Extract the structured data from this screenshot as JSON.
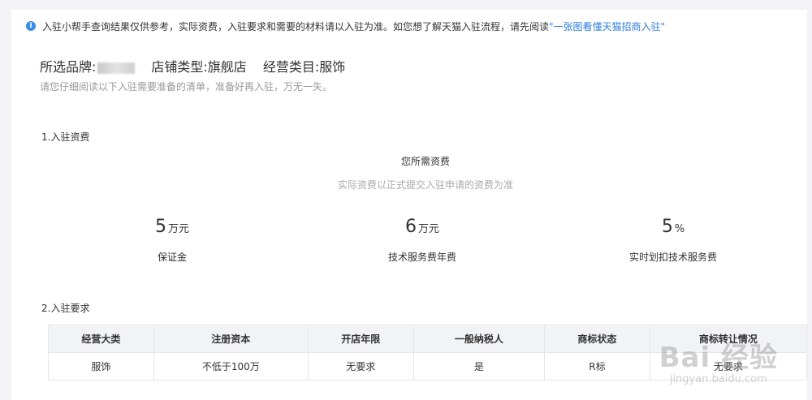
{
  "notice": {
    "text": "入驻小帮手查询结果仅供参考，实际资费，入驻要求和需要的材料请以入驻为准。如您想了解天猫入驻流程，请先阅读 ",
    "link": "\"一张图看懂天猫招商入驻\""
  },
  "selection": {
    "brand_label": "所选品牌:",
    "shop_type": "店铺类型:旗舰店",
    "category": "经营类目:服饰",
    "tip": "请您仔细阅读以下入驻需要准备的清单，准备好再入驻，万无一失。"
  },
  "section1": {
    "title": "1.入驻资费",
    "head": "您所需资费",
    "sub": "实际资费以正式提交入驻申请的资费为准",
    "fees": [
      {
        "amount": "5",
        "unit": "万元",
        "label": "保证金"
      },
      {
        "amount": "6",
        "unit": "万元",
        "label": "技术服务费年费"
      },
      {
        "amount": "5",
        "unit": "%",
        "label": "实时划扣技术服务费"
      }
    ]
  },
  "section2": {
    "title": "2.入驻要求",
    "headers": [
      "经营大类",
      "注册资本",
      "开店年限",
      "一般纳税人",
      "商标状态",
      "商标转让情况"
    ],
    "rows": [
      [
        "服饰",
        "不低于100万",
        "无要求",
        "是",
        "R标",
        "无要求"
      ]
    ]
  },
  "watermark": {
    "logo": "Bai 经验",
    "url": "jingyan.baidu.com"
  }
}
